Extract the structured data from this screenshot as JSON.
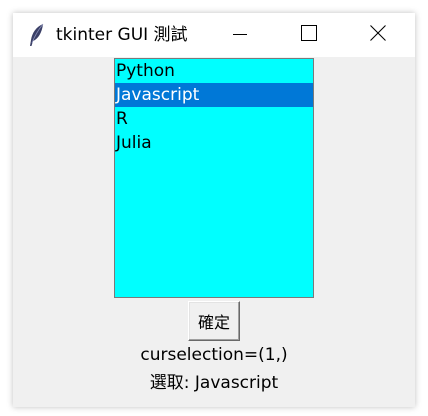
{
  "window": {
    "title": "tkinter GUI 測試"
  },
  "titlebar": {
    "icons": [
      "feather-icon",
      "minimize-icon",
      "maximize-icon",
      "close-icon"
    ]
  },
  "listbox": {
    "background_color": "#00ffff",
    "selection_color": "#0078d7",
    "items": [
      "Python",
      "Javascript",
      "R",
      "Julia"
    ],
    "selected_index": 1
  },
  "button": {
    "label": "確定"
  },
  "labels": {
    "curselection": "curselection=(1,)",
    "selected": "選取: Javascript"
  }
}
